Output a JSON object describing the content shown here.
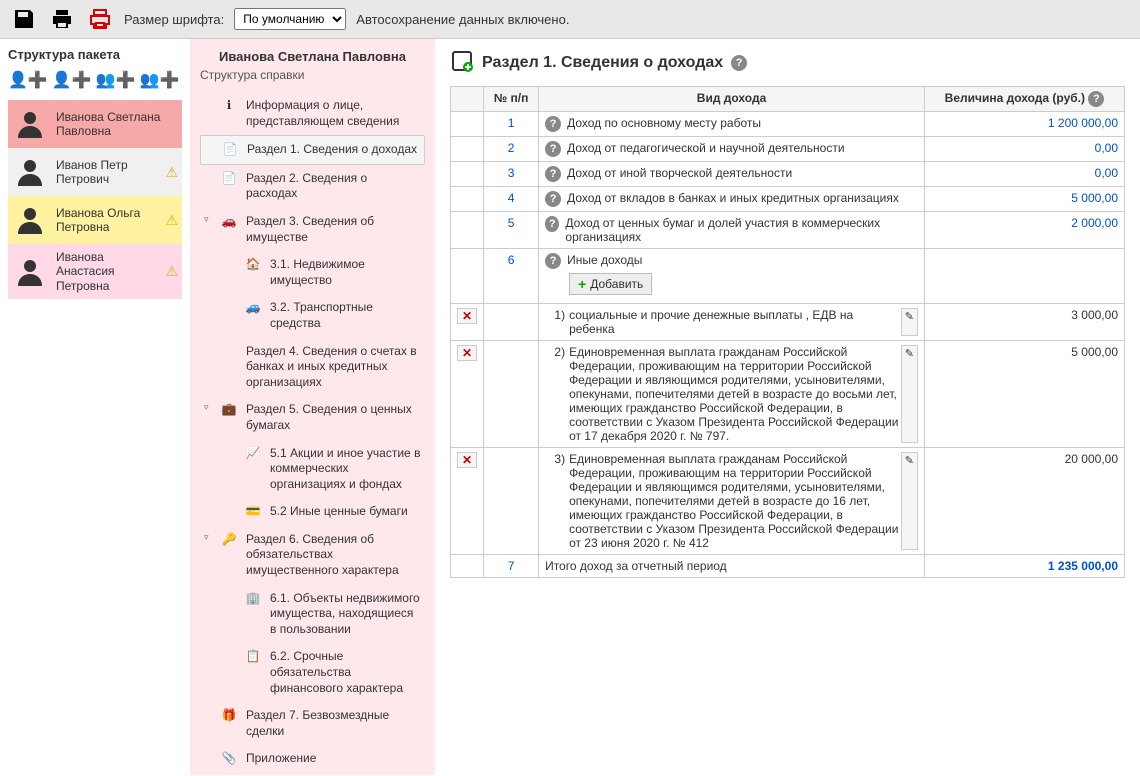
{
  "toolbar": {
    "font_label": "Размер шрифта:",
    "font_value": "По умолчанию",
    "autosave": "Автосохранение данных включено."
  },
  "sidebar_left": {
    "title": "Структура пакета",
    "people": [
      {
        "name": "Иванова Светлана Павловна",
        "cls": "active",
        "warn": false,
        "gender": "f"
      },
      {
        "name": "Иванов Петр Петрович",
        "cls": "alt1",
        "warn": true,
        "gender": "m"
      },
      {
        "name": "Иванова Ольга Петровна",
        "cls": "alt2",
        "warn": true,
        "gender": "f"
      },
      {
        "name": "Иванова Анастасия Петровна",
        "cls": "alt3",
        "warn": true,
        "gender": "f"
      }
    ]
  },
  "sidebar_mid": {
    "title": "Иванова Светлана Павловна",
    "subtitle": "Структура справки",
    "items": [
      {
        "icon": "ℹ",
        "text": "Информация о лице, представляющем сведения",
        "expand": ""
      },
      {
        "icon": "📄",
        "text": "Раздел 1. Сведения о доходах",
        "expand": "",
        "selected": true
      },
      {
        "icon": "📄",
        "text": "Раздел 2. Сведения о расходах",
        "expand": ""
      },
      {
        "icon": "🚗",
        "text": "Раздел 3. Сведения об имуществе",
        "expand": "▿"
      },
      {
        "icon": "🏠",
        "text": "3.1. Недвижимое имущество",
        "expand": "",
        "sub": true
      },
      {
        "icon": "🚙",
        "text": "3.2. Транспортные средства",
        "expand": "",
        "sub": true
      },
      {
        "icon": "",
        "text": "Раздел 4. Сведения о счетах в банках и иных кредитных организациях",
        "expand": ""
      },
      {
        "icon": "💼",
        "text": "Раздел 5. Сведения о ценных бумагах",
        "expand": "▿"
      },
      {
        "icon": "📈",
        "text": "5.1 Акции и иное участие в коммерческих организациях и фондах",
        "expand": "",
        "sub": true
      },
      {
        "icon": "💳",
        "text": "5.2 Иные ценные бумаги",
        "expand": "",
        "sub": true
      },
      {
        "icon": "🔑",
        "text": "Раздел 6. Сведения об обязательствах имущественного характера",
        "expand": "▿"
      },
      {
        "icon": "🏢",
        "text": "6.1. Объекты недвижимого имущества, находящиеся в пользовании",
        "expand": "",
        "sub": true
      },
      {
        "icon": "📋",
        "text": "6.2. Срочные обязательства финансового характера",
        "expand": "",
        "sub": true
      },
      {
        "icon": "🎁",
        "text": "Раздел 7. Безвозмездные сделки",
        "expand": ""
      },
      {
        "icon": "📎",
        "text": "Приложение",
        "expand": ""
      }
    ]
  },
  "content": {
    "title": "Раздел 1. Сведения о доходах",
    "headers": {
      "num": "№ п/п",
      "type": "Вид дохода",
      "amount": "Величина дохода (руб.)"
    },
    "rows": [
      {
        "n": "1",
        "type": "Доход по основному месту работы",
        "amount": "1 200 000,00"
      },
      {
        "n": "2",
        "type": "Доход от педагогической и научной деятельности",
        "amount": "0,00"
      },
      {
        "n": "3",
        "type": "Доход от иной творческой деятельности",
        "amount": "0,00"
      },
      {
        "n": "4",
        "type": "Доход от вкладов в банках и иных кредитных организациях",
        "amount": "5 000,00"
      },
      {
        "n": "5",
        "type": "Доход от ценных бумаг и долей участия в коммерческих организациях",
        "amount": "2 000,00"
      }
    ],
    "row6_n": "6",
    "row6_type": "Иные доходы",
    "add_label": "Добавить",
    "subrows": [
      {
        "n": "1)",
        "text": "социальные и прочие денежные выплаты , ЕДВ на ребенка",
        "amount": "3 000,00"
      },
      {
        "n": "2)",
        "text": "Единовременная выплата гражданам Российской Федерации, проживающим на территории Российской Федерации и являющимся родителями, усыновителями, опекунами, попечителями детей в возрасте до восьми лет, имеющих гражданство Российской Федерации, в соответствии с Указом Президента Российской Федерации от 17 декабря 2020 г. № 797.",
        "amount": "5 000,00"
      },
      {
        "n": "3)",
        "text": "Единовременная выплата гражданам Российской Федерации, проживающим на территории Российской Федерации и являющимся родителями, усыновителями, опекунами, попечителями детей в возрасте до 16 лет, имеющих гражданство Российской Федерации, в соответствии с Указом Президента Российской Федерации от 23 июня 2020 г. № 412",
        "amount": "20 000,00"
      }
    ],
    "total_n": "7",
    "total_label": "Итого доход за отчетный период",
    "total_amount": "1 235 000,00"
  }
}
